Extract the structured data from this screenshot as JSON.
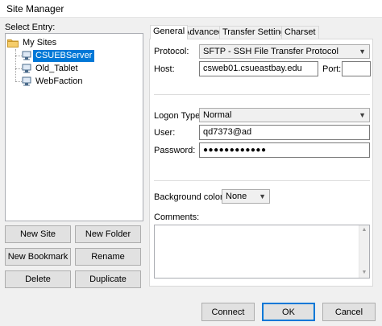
{
  "window": {
    "title": "Site Manager"
  },
  "left": {
    "select_entry_label": "Select Entry:",
    "tree": {
      "root": "My Sites",
      "items": [
        {
          "label": "CSUEBServer",
          "selected": true
        },
        {
          "label": "Old_Tablet",
          "selected": false
        },
        {
          "label": "WebFaction",
          "selected": false
        }
      ]
    },
    "buttons": {
      "new_site": "New Site",
      "new_folder": "New Folder",
      "new_bookmark": "New Bookmark",
      "rename": "Rename",
      "delete": "Delete",
      "duplicate": "Duplicate"
    }
  },
  "tabs": [
    {
      "label": "General",
      "active": true
    },
    {
      "label": "Advanced",
      "active": false
    },
    {
      "label": "Transfer Settings",
      "active": false
    },
    {
      "label": "Charset",
      "active": false
    }
  ],
  "general": {
    "protocol_label": "Protocol:",
    "protocol_value": "SFTP - SSH File Transfer Protocol",
    "host_label": "Host:",
    "host_value": "csweb01.csueastbay.edu",
    "port_label": "Port:",
    "port_value": "",
    "logon_type_label": "Logon Type:",
    "logon_type_value": "Normal",
    "user_label": "User:",
    "user_value": "qd7373@ad",
    "password_label": "Password:",
    "password_value": "●●●●●●●●●●●●",
    "background_color_label": "Background color:",
    "background_color_value": "None",
    "comments_label": "Comments:",
    "comments_value": ""
  },
  "footer": {
    "connect": "Connect",
    "ok": "OK",
    "cancel": "Cancel"
  },
  "colors": {
    "selection": "#0078d7",
    "folder": "#e8b64a"
  }
}
